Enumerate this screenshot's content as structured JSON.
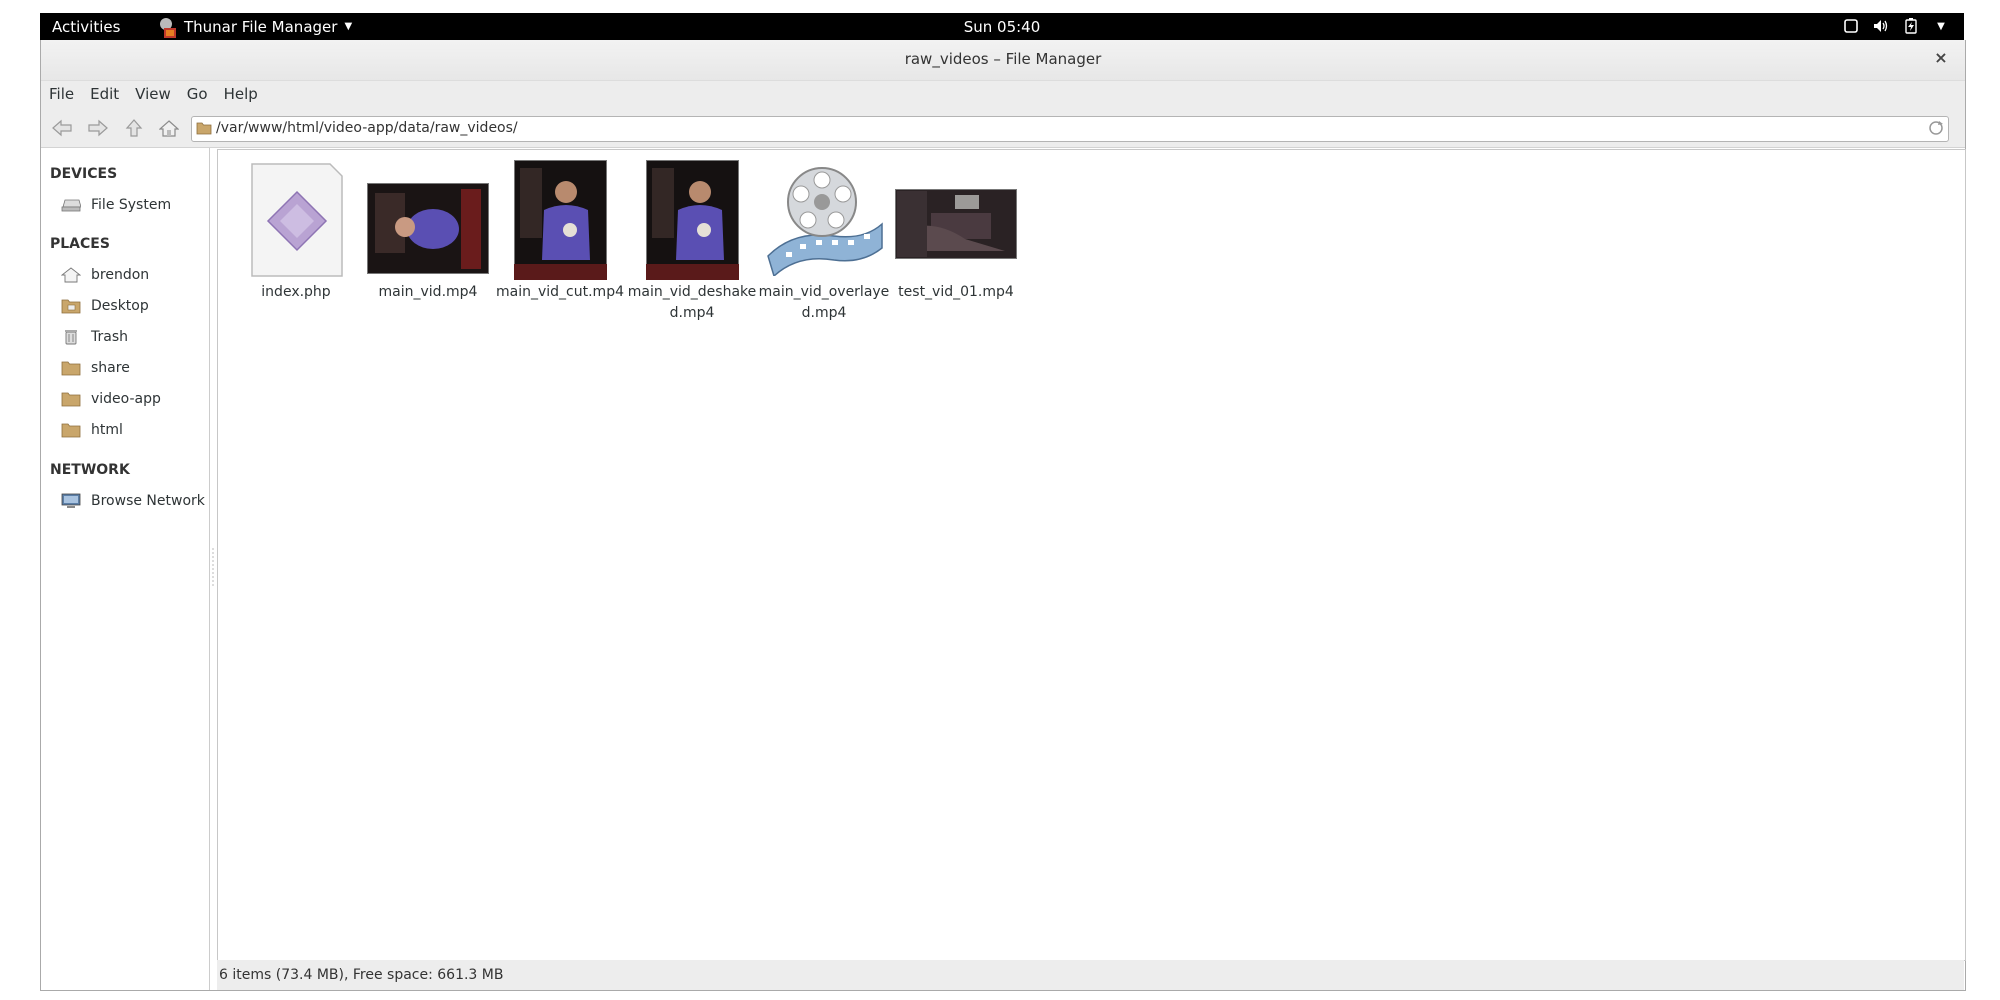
{
  "topbar": {
    "activities": "Activities",
    "app_name": "Thunar File Manager",
    "clock": "Sun 05:40",
    "status_icons": [
      "window-icon",
      "volume-icon",
      "battery-icon",
      "chevron-down-icon"
    ]
  },
  "window": {
    "title": "raw_videos – File Manager",
    "close": "×"
  },
  "menubar": {
    "items": [
      "File",
      "Edit",
      "View",
      "Go",
      "Help"
    ]
  },
  "toolbar": {
    "location": "/var/www/html/video-app/data/raw_videos/"
  },
  "sidebar": {
    "devices_label": "DEVICES",
    "devices": [
      {
        "label": "File System",
        "icon": "drive-icon"
      }
    ],
    "places_label": "PLACES",
    "places": [
      {
        "label": "brendon",
        "icon": "home-icon"
      },
      {
        "label": "Desktop",
        "icon": "desktop-folder-icon"
      },
      {
        "label": "Trash",
        "icon": "trash-icon"
      },
      {
        "label": "share",
        "icon": "folder-icon"
      },
      {
        "label": "video-app",
        "icon": "folder-icon"
      },
      {
        "label": "html",
        "icon": "folder-icon"
      }
    ],
    "network_label": "NETWORK",
    "network": [
      {
        "label": "Browse Network",
        "icon": "network-icon"
      }
    ]
  },
  "files": [
    {
      "name": "index.php",
      "icon": "php-file-icon"
    },
    {
      "name": "main_vid.mp4",
      "icon": "video-thumbnail"
    },
    {
      "name": "main_vid_cut.mp4",
      "icon": "video-thumbnail"
    },
    {
      "name": "main_vid_deshaked.mp4",
      "icon": "video-thumbnail"
    },
    {
      "name": "main_vid_overlayed.mp4",
      "icon": "film-reel-icon"
    },
    {
      "name": "test_vid_01.mp4",
      "icon": "video-thumbnail"
    }
  ],
  "statusbar": {
    "text": "6 items (73.4 MB), Free space: 661.3 MB"
  }
}
